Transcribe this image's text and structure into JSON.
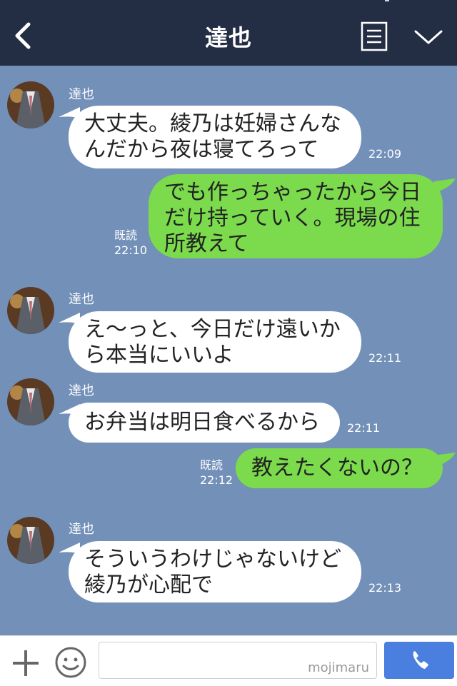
{
  "header": {
    "title": "達也",
    "back_icon": "chevron-left-icon",
    "menu_icon": "menu-list-icon",
    "collapse_icon": "chevron-down-icon",
    "background": "#232d44"
  },
  "chat": {
    "background": "#7390b8",
    "incoming_bubble_color": "#ffffff",
    "outgoing_bubble_color": "#7bdb4c",
    "messages": [
      {
        "direction": "in",
        "sender": "達也",
        "lines": [
          "大丈夫。綾乃は妊婦さんな",
          "んだから夜は寝てろって"
        ],
        "time": "22:09"
      },
      {
        "direction": "out",
        "lines": [
          "でも作っちゃったから今日",
          "だけ持っていく。現場の住",
          "所教えて"
        ],
        "read": "既読",
        "time": "22:10"
      },
      {
        "direction": "in",
        "sender": "達也",
        "lines": [
          "え〜っと、今日だけ遠いか",
          "ら本当にいいよ"
        ],
        "time": "22:11"
      },
      {
        "direction": "in",
        "sender": "達也",
        "lines": [
          "お弁当は明日食べるから"
        ],
        "time": "22:11"
      },
      {
        "direction": "out",
        "lines": [
          "教えたくないの？"
        ],
        "read": "既読",
        "time": "22:12"
      },
      {
        "direction": "in",
        "sender": "達也",
        "lines": [
          "そういうわけじゃないけど",
          "綾乃が心配で"
        ],
        "time": "22:13"
      }
    ]
  },
  "footer": {
    "plus_icon": "plus-icon",
    "sticker_icon": "smiley-icon",
    "input_value": "",
    "watermark": "mojimaru",
    "call_icon": "phone-icon",
    "call_color": "#4a7fe0"
  }
}
